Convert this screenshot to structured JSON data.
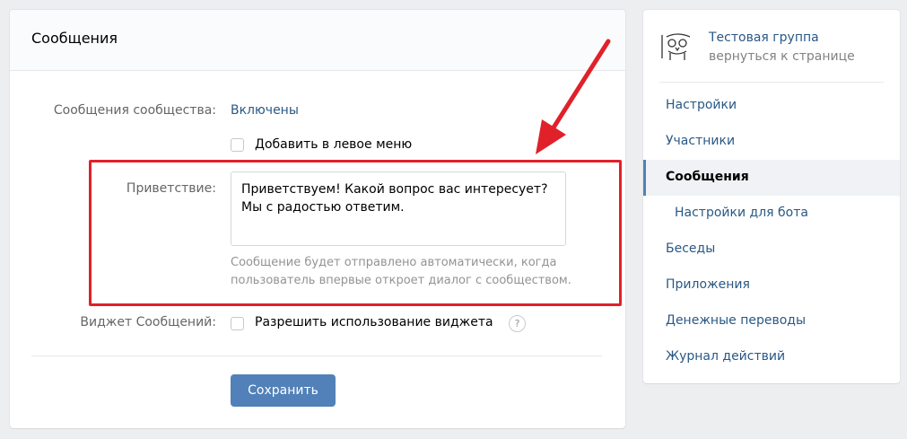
{
  "main": {
    "title": "Сообщения",
    "rows": {
      "messages_label": "Сообщения сообщества:",
      "messages_value": "Включены",
      "left_menu_checkbox": "Добавить в левое меню",
      "greeting_label": "Приветствие:",
      "greeting_text": "Приветствуем! Какой вопрос вас интересует?\nМы с радостью ответим.",
      "greeting_hint": "Сообщение будет отправлено автоматически, когда пользователь впервые откроет диалог с сообществом.",
      "widget_label": "Виджет Сообщений:",
      "widget_checkbox": "Разрешить использование виджета",
      "help_glyph": "?"
    },
    "save_button": "Сохранить"
  },
  "sidebar": {
    "group_name": "Тестовая группа",
    "group_back": "вернуться к странице",
    "items": [
      {
        "label": "Настройки"
      },
      {
        "label": "Участники"
      },
      {
        "label": "Сообщения"
      },
      {
        "label": "Настройки для бота"
      },
      {
        "label": "Беседы"
      },
      {
        "label": "Приложения"
      },
      {
        "label": "Денежные переводы"
      },
      {
        "label": "Журнал действий"
      }
    ]
  },
  "colors": {
    "accent": "#5181b8",
    "link": "#2a5885",
    "highlight_red": "#e0212a",
    "background": "#edeef0"
  },
  "icons": {
    "group_avatar": "group-avatar-icon",
    "help": "question-icon",
    "annotation_arrow": "arrow-icon"
  }
}
